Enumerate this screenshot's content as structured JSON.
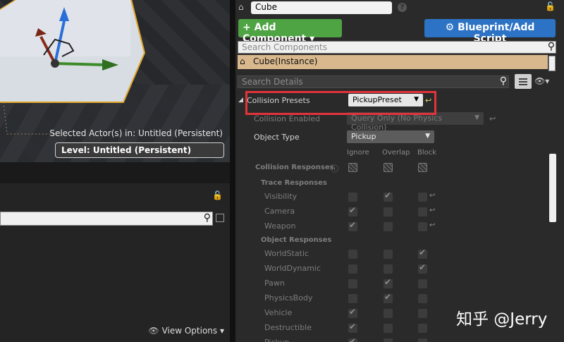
{
  "viewport": {
    "selected_actor": "Selected Actor(s) in:  Untitled (Persistent)",
    "level": "Level:  Untitled (Persistent)"
  },
  "lower_panel": {
    "view_options": "View Options"
  },
  "details": {
    "actor_name": "Cube",
    "add_component": "Add Component",
    "blueprint_button": "Blueprint/Add Script",
    "search_components_placeholder": "Search Components",
    "instance_label": "Cube(Instance)",
    "search_details_placeholder": "Search Details",
    "collision_presets_label": "Collision Presets",
    "collision_presets_value": "PickupPreset",
    "collision_enabled_label": "Collision Enabled",
    "collision_enabled_value": "Query Only (No Physics Collision)",
    "object_type_label": "Object Type",
    "object_type_value": "Pickup",
    "columns": [
      "Ignore",
      "Overlap",
      "Block"
    ],
    "collision_responses_label": "Collision Responses",
    "trace_responses_label": "Trace Responses",
    "object_responses_label": "Object Responses",
    "responses": [
      {
        "label": "Visibility",
        "checked": "overlap",
        "reset": true
      },
      {
        "label": "Camera",
        "checked": "ignore",
        "reset": true
      },
      {
        "label": "Weapon",
        "checked": "ignore",
        "reset": true
      },
      {
        "label": "WorldStatic",
        "checked": "block",
        "reset": false
      },
      {
        "label": "WorldDynamic",
        "checked": "block",
        "reset": false
      },
      {
        "label": "Pawn",
        "checked": "overlap",
        "reset": false
      },
      {
        "label": "PhysicsBody",
        "checked": "overlap",
        "reset": false
      },
      {
        "label": "Vehicle",
        "checked": "ignore",
        "reset": false
      },
      {
        "label": "Destructible",
        "checked": "ignore",
        "reset": false
      },
      {
        "label": "Pickup",
        "checked": "ignore",
        "reset": false
      }
    ]
  },
  "watermark": "知乎 @Jerry",
  "colors": {
    "add_component": "#4ea343",
    "blueprint": "#2c73c5",
    "instance_row": "#d9b88e",
    "highlight": "#e0343a",
    "reset_arrow": "#e6d35b"
  }
}
